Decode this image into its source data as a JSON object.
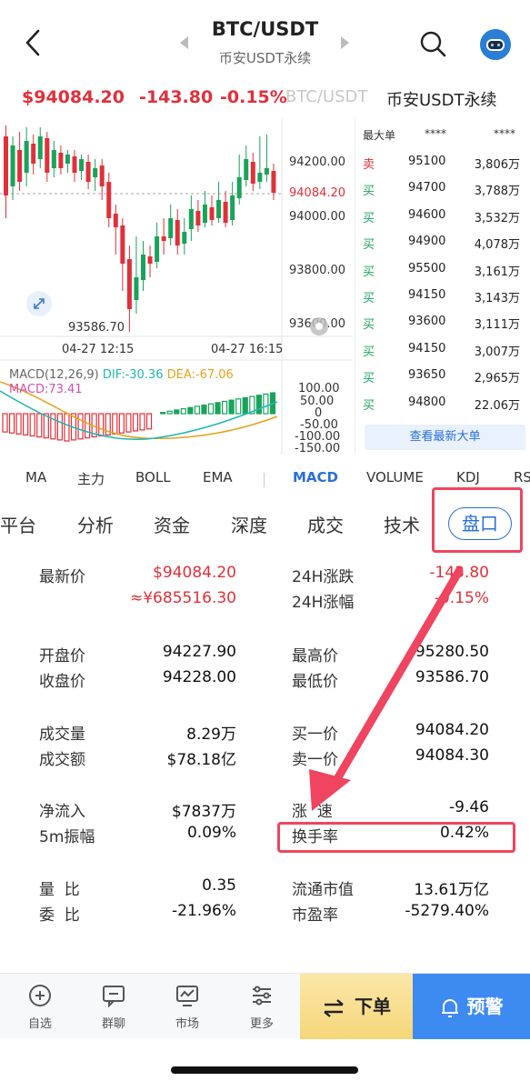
{
  "header": {
    "title": "BTC/USDT",
    "subtitle": "币安USDT永续"
  },
  "price_line": {
    "price": "$94084.20",
    "change": "-143.80",
    "change_pct": "-0.15%",
    "pair": "BTC/USDT",
    "market": "币安USDT永续"
  },
  "chart": {
    "y_ticks": [
      "94200.00",
      "94000.00",
      "93800.00",
      "93600.00"
    ],
    "current_price_tag": "94084.20",
    "low_label": "93586.70",
    "x_ticks": [
      "04-27 12:15",
      "04-27 16:15"
    ],
    "macd_label": "MACD(12,26,9)",
    "dif_label": "DIF:-30.36",
    "dea_label": "DEA:-67.06",
    "macd_value": "MACD:73.41",
    "macd_ticks": [
      "100.00",
      "50.00",
      "0",
      "-50.00",
      "-100.00",
      "-150.00"
    ]
  },
  "orders": {
    "head_label": "最大单",
    "head_mask1": "****",
    "head_mask2": "****",
    "rows": [
      {
        "side": "卖",
        "price": "95100",
        "amount": "3,806万"
      },
      {
        "side": "买",
        "price": "94700",
        "amount": "3,788万"
      },
      {
        "side": "买",
        "price": "94600",
        "amount": "3,532万"
      },
      {
        "side": "买",
        "price": "94900",
        "amount": "4,078万"
      },
      {
        "side": "买",
        "price": "95500",
        "amount": "3,161万"
      },
      {
        "side": "买",
        "price": "94150",
        "amount": "3,143万"
      },
      {
        "side": "买",
        "price": "93600",
        "amount": "3,111万"
      },
      {
        "side": "买",
        "price": "94150",
        "amount": "3,007万"
      },
      {
        "side": "买",
        "price": "93650",
        "amount": "2,965万"
      },
      {
        "side": "买",
        "price": "94800",
        "amount": "22.06万"
      }
    ],
    "latest_button": "查看最新大单"
  },
  "indicators": [
    "MA",
    "主力",
    "BOLL",
    "EMA",
    "MACD",
    "VOLUME",
    "KDJ",
    "RS"
  ],
  "tabs": [
    "平台",
    "分析",
    "资金",
    "深度",
    "成交",
    "技术",
    "盘口"
  ],
  "stats": {
    "latest_price_label": "最新价",
    "latest_price": "$94084.20",
    "latest_price_cny": "≈¥685516.30",
    "chg24_label": "24H涨跌",
    "chg24": "-143.80",
    "chgpct24_label": "24H涨幅",
    "chgpct24": "-0.15%",
    "open_label": "开盘价",
    "open": "94227.90",
    "close_label": "收盘价",
    "close": "94228.00",
    "high_label": "最高价",
    "high": "95280.50",
    "low_label": "最低价",
    "low": "93586.70",
    "volume_label": "成交量",
    "volume": "8.29万",
    "turnover_label": "成交额",
    "turnover": "$78.18亿",
    "bid_label": "买一价",
    "bid": "94084.20",
    "ask_label": "卖一价",
    "ask": "94084.30",
    "netflow_label": "净流入",
    "netflow": "$7837万",
    "amp5_label": "5m振幅",
    "amp5": "0.09%",
    "speed_label": "涨  速",
    "speed": "-9.46",
    "turnrate_label": "换手率",
    "turnrate": "0.42%",
    "volratio_label": "量  比",
    "volratio": "0.35",
    "commit_label": "委  比",
    "commit": "-21.96%",
    "circcap_label": "流通市值",
    "circcap": "13.61万亿",
    "pe_label": "市盈率",
    "pe": "-5279.40%"
  },
  "bottom": {
    "watchlist": "自选",
    "chat": "群聊",
    "market": "市场",
    "more": "更多",
    "order": "下单",
    "alert": "预警"
  },
  "colors": {
    "up": "#1aa35a",
    "down": "#e0303a",
    "accent": "#2a6fd8",
    "highlight": "#ef4560"
  }
}
